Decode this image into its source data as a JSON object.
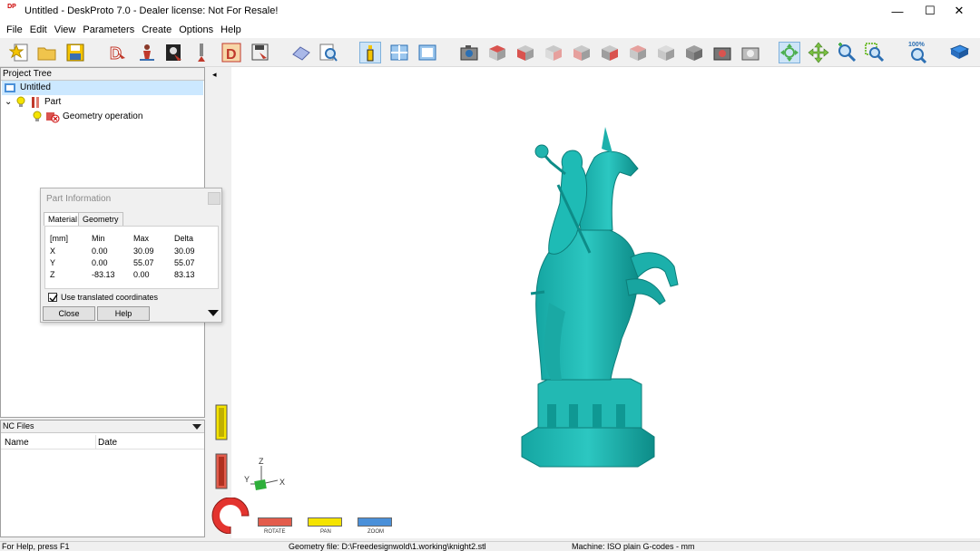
{
  "window": {
    "title": "Untitled - DeskProto 7.0 - Dealer license: Not For Resale!",
    "app_icon_text": "DP",
    "controls": {
      "minimize": "—",
      "maximize": "☐",
      "close": "✕"
    }
  },
  "menu": [
    "File",
    "Edit",
    "View",
    "Parameters",
    "Create",
    "Options",
    "Help"
  ],
  "toolbar": {
    "zoom_100_label": "100%",
    "cube_colors": {
      "red": "#d9534f",
      "gray": "#c8c8c8",
      "dark": "#6d6d6d"
    }
  },
  "project_tree": {
    "header": "Project Tree",
    "items": [
      {
        "label": "Untitled",
        "selected": true
      },
      {
        "label": "Part",
        "expander": "⌄"
      },
      {
        "label": "Geometry operation"
      }
    ]
  },
  "nc_files": {
    "header": "NC Files",
    "columns": [
      "Name",
      "Date"
    ]
  },
  "part_info": {
    "title": "Part Information",
    "tabs": [
      "Material",
      "Geometry"
    ],
    "active_tab": "Material",
    "headers": [
      "[mm]",
      "Min",
      "Max",
      "Delta"
    ],
    "rows": [
      [
        "X",
        "0.00",
        "30.09",
        "30.09"
      ],
      [
        "Y",
        "0.00",
        "55.07",
        "55.07"
      ],
      [
        "Z",
        "-83.13",
        "0.00",
        "83.13"
      ]
    ],
    "checkbox_label": "Use translated coordinates",
    "checkbox_checked": true,
    "buttons": {
      "close": "Close",
      "help": "Help"
    }
  },
  "viewport": {
    "model_color": "#1fb5b0",
    "axes": {
      "z": "Z",
      "y": "Y",
      "x": "X"
    },
    "mode_labels": {
      "rotate": "ROTATE",
      "pan": "PAN",
      "zoom": "ZOOM"
    },
    "collapse_arrow": "◂"
  },
  "statusbar": {
    "help": "For Help, press F1",
    "geometry_file": "Geometry file: D:\\Freedesignwold\\1.working\\knight2.stl",
    "machine": "Machine: ISO plain G-codes - mm"
  }
}
